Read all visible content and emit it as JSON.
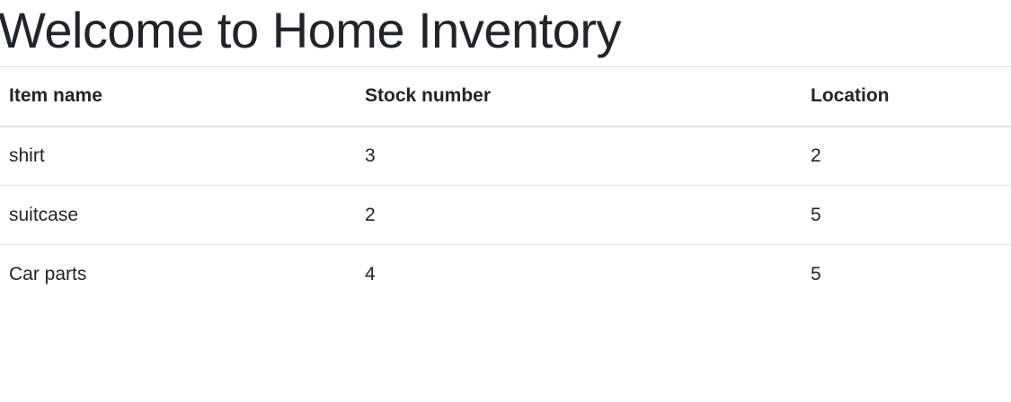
{
  "page": {
    "title": "Welcome to Home Inventory"
  },
  "table": {
    "headers": {
      "item_name": "Item name",
      "stock_number": "Stock number",
      "location": "Location"
    },
    "rows": [
      {
        "item_name": "shirt",
        "stock_number": "3",
        "location": "2"
      },
      {
        "item_name": "suitcase",
        "stock_number": "2",
        "location": "5"
      },
      {
        "item_name": "Car parts",
        "stock_number": "4",
        "location": "5"
      }
    ]
  },
  "colors": {
    "text": "#212529",
    "border": "#dee2e6",
    "background": "#ffffff"
  }
}
